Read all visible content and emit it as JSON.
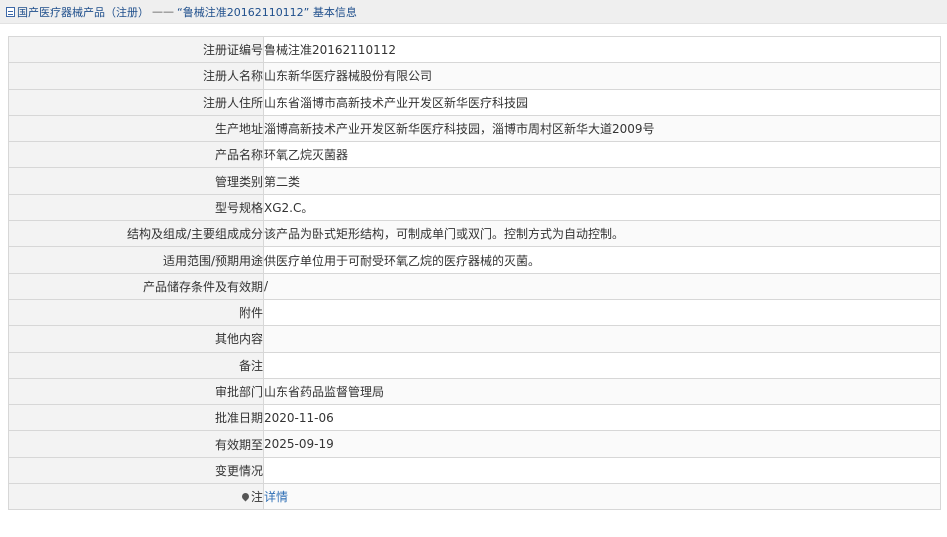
{
  "breadcrumb": {
    "root": "国产医疗器械产品（注册）",
    "separator": "——",
    "current": "“鲁械注准20162110112”  基本信息"
  },
  "rows": [
    {
      "label": "注册证编号",
      "value": "鲁械注准20162110112"
    },
    {
      "label": "注册人名称",
      "value": "山东新华医疗器械股份有限公司"
    },
    {
      "label": "注册人住所",
      "value": "山东省淄博市高新技术产业开发区新华医疗科技园"
    },
    {
      "label": "生产地址",
      "value": "淄博高新技术产业开发区新华医疗科技园，淄博市周村区新华大道2009号"
    },
    {
      "label": "产品名称",
      "value": "环氧乙烷灭菌器"
    },
    {
      "label": "管理类别",
      "value": "第二类"
    },
    {
      "label": "型号规格",
      "value": "XG2.C。"
    },
    {
      "label": "结构及组成/主要组成成分",
      "value": "该产品为卧式矩形结构，可制成单门或双门。控制方式为自动控制。"
    },
    {
      "label": "适用范围/预期用途",
      "value": "供医疗单位用于可耐受环氧乙烷的医疗器械的灭菌。"
    },
    {
      "label": "产品储存条件及有效期",
      "value": "/"
    },
    {
      "label": "附件",
      "value": ""
    },
    {
      "label": "其他内容",
      "value": ""
    },
    {
      "label": "备注",
      "value": ""
    },
    {
      "label": "审批部门",
      "value": "山东省药品监督管理局"
    },
    {
      "label": "批准日期",
      "value": "2020-11-06"
    },
    {
      "label": "有效期至",
      "value": "2025-09-19"
    },
    {
      "label": "变更情况",
      "value": ""
    }
  ],
  "note_row": {
    "label": "注",
    "icon": "pin-icon",
    "link": "详情"
  },
  "colors": {
    "link": "#2f6fb5",
    "breadcrumb": "#1f4f8c",
    "label_bg": "#f3f3f3",
    "border": "#d7d7d7"
  }
}
